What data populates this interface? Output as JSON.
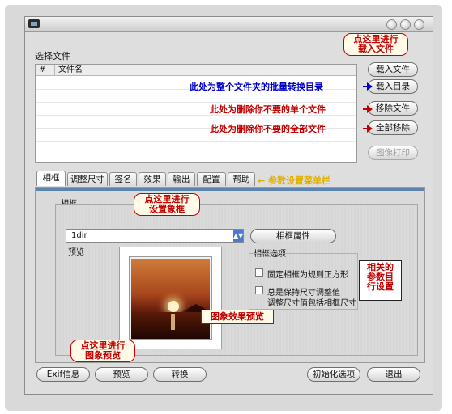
{
  "window": {
    "title": ""
  },
  "file_section": {
    "label": "选择文件",
    "columns": [
      "#",
      "文件名"
    ]
  },
  "side_buttons": {
    "load_file": "载入文件",
    "load_dir": "载入目录",
    "remove_file": "移除文件",
    "remove_all": "全部移除",
    "print": "图像打印"
  },
  "annotations": {
    "load_file_callout": [
      "点这里进行",
      "载入文件"
    ],
    "load_dir_note": "此处为整个文件夹的批量转换目录",
    "remove_file_note": "此处为删除你不要的单个文件",
    "remove_all_note": "此处为删除你不要的全部文件",
    "tabs_note": "参数设置菜单栏",
    "frame_callout": [
      "点这里进行",
      "设置象框"
    ],
    "preview_fx": "图象效果预览",
    "params_box": [
      "相关的",
      "参数目",
      "行设置"
    ],
    "preview_callout": [
      "点这里进行",
      "图象预览"
    ]
  },
  "tabs": [
    "相框",
    "调整尺寸",
    "签名",
    "效果",
    "输出",
    "配置",
    "帮助"
  ],
  "frame_panel": {
    "group_label": "相框",
    "select_value": "1dir",
    "props_button": "相框属性",
    "preview_label": "预览",
    "options_label": "相框选项",
    "option1": "固定相框为规则正方形",
    "option2_line1": "总是保持尺寸调整值",
    "option2_line2": "调整尺寸值包括相框尺寸"
  },
  "bottom_buttons": {
    "exif": "Exif信息",
    "preview": "预览",
    "convert": "转换",
    "init": "初始化选项",
    "exit": "退出"
  },
  "colors": {
    "annotation_red": "#c20000",
    "annotation_blue": "#0000cc",
    "annotation_yellow": "#e0b000",
    "tab_stripe": "#5b84b1"
  }
}
